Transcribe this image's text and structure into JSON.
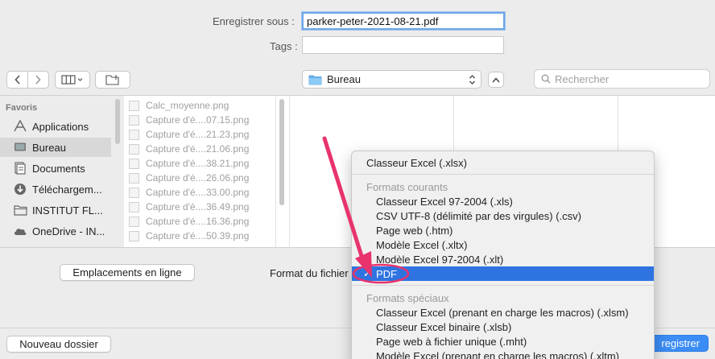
{
  "save": {
    "save_as_label": "Enregistrer sous :",
    "filename": "parker-peter-2021-08-21.pdf",
    "tags_label": "Tags :",
    "tags_value": ""
  },
  "toolbar": {
    "location": "Bureau",
    "search_placeholder": "Rechercher"
  },
  "sidebar": {
    "title": "Favoris",
    "items": [
      {
        "label": "Applications",
        "icon": "applications-icon"
      },
      {
        "label": "Bureau",
        "icon": "desktop-icon"
      },
      {
        "label": "Documents",
        "icon": "documents-icon"
      },
      {
        "label": "Téléchargem...",
        "icon": "downloads-icon"
      },
      {
        "label": "INSTITUT FL...",
        "icon": "folder-icon"
      },
      {
        "label": "OneDrive - IN...",
        "icon": "cloud-icon"
      }
    ]
  },
  "files": [
    "Calc_moyenne.png",
    "Capture d'é....07.15.png",
    "Capture d'é....21.23.png",
    "Capture d'é....21.06.png",
    "Capture d'é....38.21.png",
    "Capture d'é....26.06.png",
    "Capture d'é....33.00.png",
    "Capture d'é....36.49.png",
    "Capture d'é....16.36.png",
    "Capture d'é....50.39.png"
  ],
  "options": {
    "online_locations": "Emplacements en ligne",
    "format_label": "Format du fichier"
  },
  "footer": {
    "new_folder": "Nouveau dossier",
    "save_button": "Enregistrer",
    "save_button_visible": "registrer"
  },
  "format_menu": {
    "top_item": "Classeur Excel (.xlsx)",
    "common_header": "Formats courants",
    "common": [
      "Classeur Excel 97-2004 (.xls)",
      "CSV UTF-8 (délimité par des virgules) (.csv)",
      "Page web (.htm)",
      "Modèle Excel (.xltx)",
      "Modèle Excel 97-2004 (.xlt)"
    ],
    "selected": "PDF",
    "special_header": "Formats spéciaux",
    "special": [
      "Classeur Excel (prenant en charge les macros) (.xlsm)",
      "Classeur Excel binaire (.xlsb)",
      "Page web à fichier unique (.mht)",
      "Modèle Excel (prenant en charge les macros) (.xltm)"
    ]
  },
  "colors": {
    "accent": "#2e73e0",
    "annotation": "#e8336d"
  }
}
